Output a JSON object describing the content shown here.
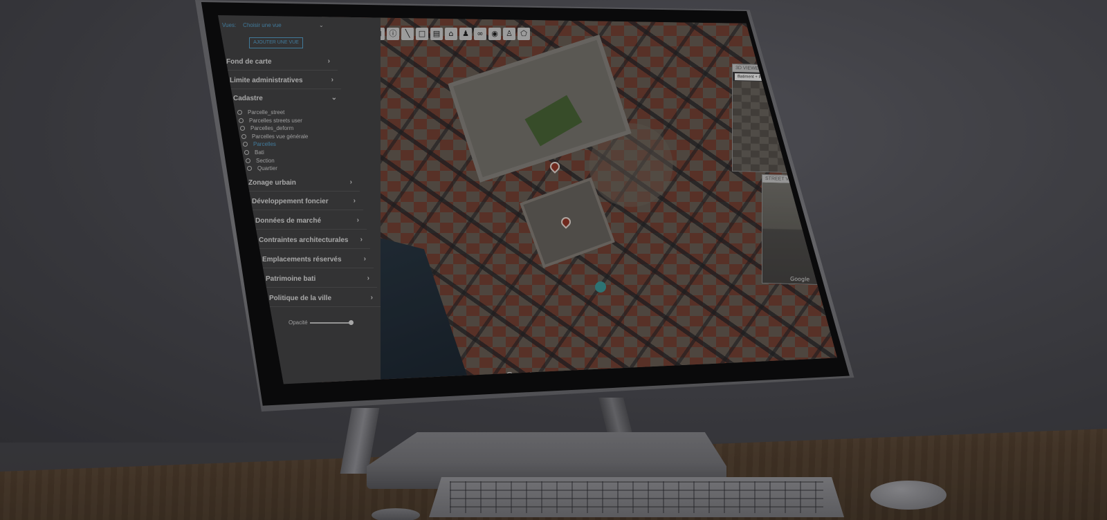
{
  "sidebar": {
    "views_label": "Vues:",
    "views_select_value": "Choisir une vue",
    "add_view_label": "AJOUTER UNE VUE",
    "categories": [
      {
        "label": "Fond de carte"
      },
      {
        "label": "Limite administratives"
      },
      {
        "label": "Cadastre"
      },
      {
        "label": "Zonage urbain"
      },
      {
        "label": "Développement foncier"
      },
      {
        "label": "Données de marché"
      },
      {
        "label": "Contraintes architecturales"
      },
      {
        "label": "Emplacements réservés"
      },
      {
        "label": "Patrimoine bati"
      },
      {
        "label": "Politique de la ville"
      }
    ],
    "cadastre_layers": [
      {
        "label": "Parcelle_street",
        "active": false
      },
      {
        "label": "Parcelles streets user",
        "active": false
      },
      {
        "label": "Parcelles_deform",
        "active": false
      },
      {
        "label": "Parcelles vue générale",
        "active": false
      },
      {
        "label": "Parcelles",
        "active": true
      },
      {
        "label": "Bati",
        "active": false
      },
      {
        "label": "Section",
        "active": false
      },
      {
        "label": "Quartier",
        "active": false
      }
    ],
    "opacity_label": "Opacité",
    "opacity_value": 1.0
  },
  "map": {
    "google_label": "Google",
    "toolbar_icons": [
      "search-icon",
      "plus-icon",
      "zoom-box-icon",
      "zoom-extent-icon",
      "info-icon",
      "measure-line-icon",
      "select-box-icon",
      "layers-icon",
      "home-icon",
      "person-icon",
      "binoculars-icon",
      "eye-icon",
      "street-view-icon",
      "polygon-icon"
    ]
  },
  "viewer_3d": {
    "title": "3D VIEWER",
    "close": "×",
    "subtitle": "Batiment + Parcelle"
  },
  "street_view": {
    "title": "STREET VIEW",
    "close": "×",
    "google_label": "Google"
  },
  "colors": {
    "sidebar_bg": "#474749",
    "accent": "#5aa9d6",
    "building_highlight": "#c8902c",
    "pin": "#9a3a2a"
  }
}
